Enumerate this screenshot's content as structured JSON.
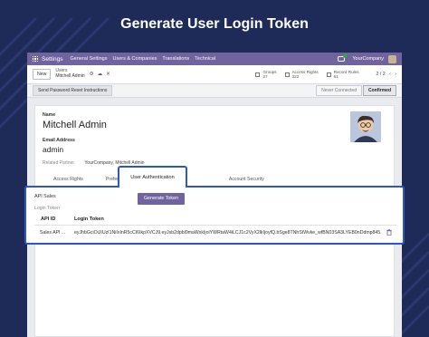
{
  "hero": {
    "title": "Generate User Login Token"
  },
  "colors": {
    "background": "#1e2a57",
    "navbar": "#71639e",
    "accent_button": "#71639e",
    "highlight_border": "#2b57c9"
  },
  "navbar": {
    "brand": "Settings",
    "menu": [
      "General Settings",
      "Users & Companies",
      "Translations",
      "Technical"
    ],
    "chat_icon": "chat-icon",
    "company": "YourCompany"
  },
  "controlbar": {
    "new_label": "New",
    "breadcrumb_parent": "Users",
    "breadcrumb_current": "Mitchell Admin",
    "gear_icon": "⚙",
    "cloud_icon": "☁",
    "discard_icon": "✕",
    "stats": [
      {
        "label": "Groups",
        "value": "27"
      },
      {
        "label": "Access Rights",
        "value": "322"
      },
      {
        "label": "Record Rules",
        "value": "61"
      }
    ],
    "pager": "2 / 2",
    "prev_icon": "‹",
    "next_icon": "›"
  },
  "statusbar": {
    "reset_label": "Send Password Reset Instructions",
    "stage_inactive": "Never Connected",
    "stage_active": "Confirmed"
  },
  "form": {
    "name_label": "Name",
    "name_value": "Mitchell Admin",
    "email_label": "Email Address",
    "login_value": "admin",
    "related_label": "Related Partner",
    "related_value": "YourCompany, Mitchell Admin"
  },
  "tabs": [
    {
      "label": "Access Rights"
    },
    {
      "label": "Preferences"
    },
    {
      "label": "User Authentication"
    },
    {
      "label": "Account Security"
    }
  ],
  "auth": {
    "api_label": "API Sales",
    "generate_label": "Generate Token",
    "login_token_section": "Login Token",
    "columns": [
      "API ID",
      "Login Token"
    ],
    "rows": [
      {
        "api_id": "Sales API ...",
        "token": "eyJhbGciOiJIUzI1NiIsInR5cCI6IkpXVCJ9.eyJsb2dpbl9maWxkIjoiYWRtaW4iLCJ1c2VyX2lkIjoyfQ.bSge8TNhStWvke_wfBN03SA3LYEB0nDdmp845..."
      }
    ],
    "delete_icon": "trash-icon"
  }
}
